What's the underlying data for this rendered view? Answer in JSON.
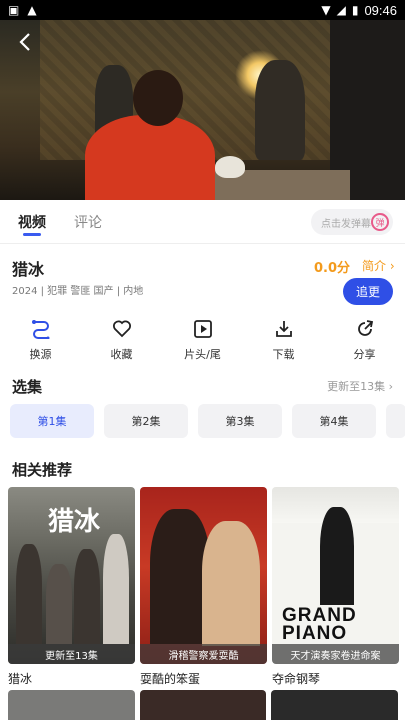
{
  "status_bar": {
    "time": "09:46"
  },
  "tabs": [
    {
      "label": "视频"
    },
    {
      "label": "评论"
    }
  ],
  "danmu": {
    "placeholder": "点击发弹幕"
  },
  "show": {
    "title": "猎冰",
    "score": "0.0分",
    "intro_label": "简介",
    "meta": "2024 | 犯罪 警匪 国产 | 内地",
    "follow_label": "追更"
  },
  "actions": [
    {
      "label": "换源",
      "icon": "switch-source-icon"
    },
    {
      "label": "收藏",
      "icon": "heart-icon"
    },
    {
      "label": "片头/尾",
      "icon": "play-skip-icon"
    },
    {
      "label": "下载",
      "icon": "download-icon"
    },
    {
      "label": "分享",
      "icon": "share-icon"
    }
  ],
  "episodes": {
    "title": "选集",
    "update": "更新至13集",
    "items": [
      "第1集",
      "第2集",
      "第3集",
      "第4集"
    ]
  },
  "recommend": {
    "title": "相关推荐",
    "items": [
      {
        "name": "猎冰",
        "tag": "更新至13集",
        "poster_text": "猎冰"
      },
      {
        "name": "耍酷的笨蛋",
        "tag": "滑稽警察爱耍酷"
      },
      {
        "name": "夺命钢琴",
        "tag": "天才演奏家卷进命案",
        "poster_text": "GRAND PIANO"
      }
    ]
  },
  "colors": {
    "accent": "#2f4fe6",
    "score": "#f39a1c"
  }
}
